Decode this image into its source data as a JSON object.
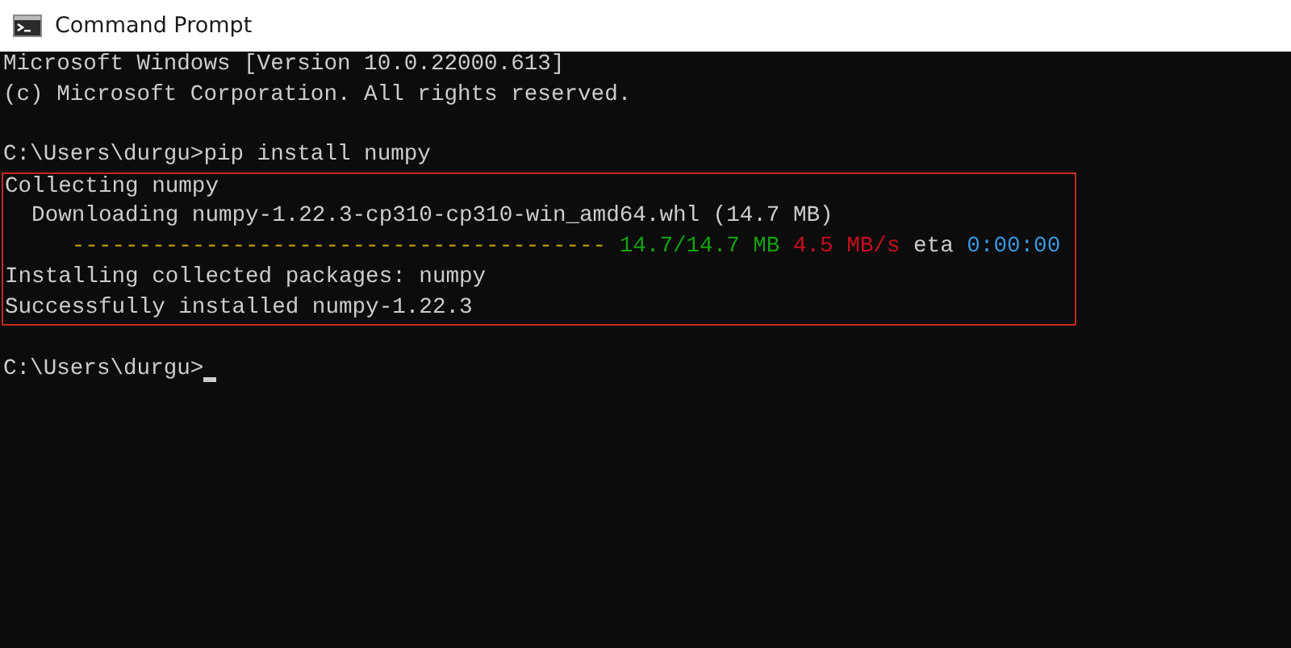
{
  "window": {
    "title": "Command Prompt"
  },
  "console": {
    "blocks": [
      {
        "kind": "plain",
        "lines": [
          {
            "kind": "text",
            "text": "Microsoft Windows [Version 10.0.22000.613]"
          },
          {
            "kind": "text",
            "text": "(c) Microsoft Corporation. All rights reserved."
          },
          {
            "kind": "blank"
          },
          {
            "kind": "text",
            "text": "C:\\Users\\durgu>pip install numpy"
          }
        ]
      },
      {
        "kind": "highlighted",
        "lines": [
          {
            "kind": "text",
            "text": "Collecting numpy"
          },
          {
            "kind": "text",
            "text": "  Downloading numpy-1.22.3-cp310-cp310-win_amd64.whl (14.7 MB)"
          },
          {
            "kind": "segments",
            "segments": [
              {
                "text": "     ----------------------------------------",
                "color": "#c19c00"
              },
              {
                "text": " 14.7/14.7 MB",
                "color": "#13a10e"
              },
              {
                "text": " 4.5 MB/s",
                "color": "#c50f1f"
              },
              {
                "text": " eta",
                "color": "#cccccc"
              },
              {
                "text": " 0:00:00",
                "color": "#3a96dd"
              }
            ]
          },
          {
            "kind": "text",
            "text": "Installing collected packages: numpy"
          },
          {
            "kind": "text",
            "text": "Successfully installed numpy-1.22.3"
          }
        ]
      },
      {
        "kind": "plain",
        "lines": [
          {
            "kind": "blank"
          },
          {
            "kind": "prompt",
            "text": "C:\\Users\\durgu>",
            "cursor": true
          }
        ]
      }
    ]
  }
}
